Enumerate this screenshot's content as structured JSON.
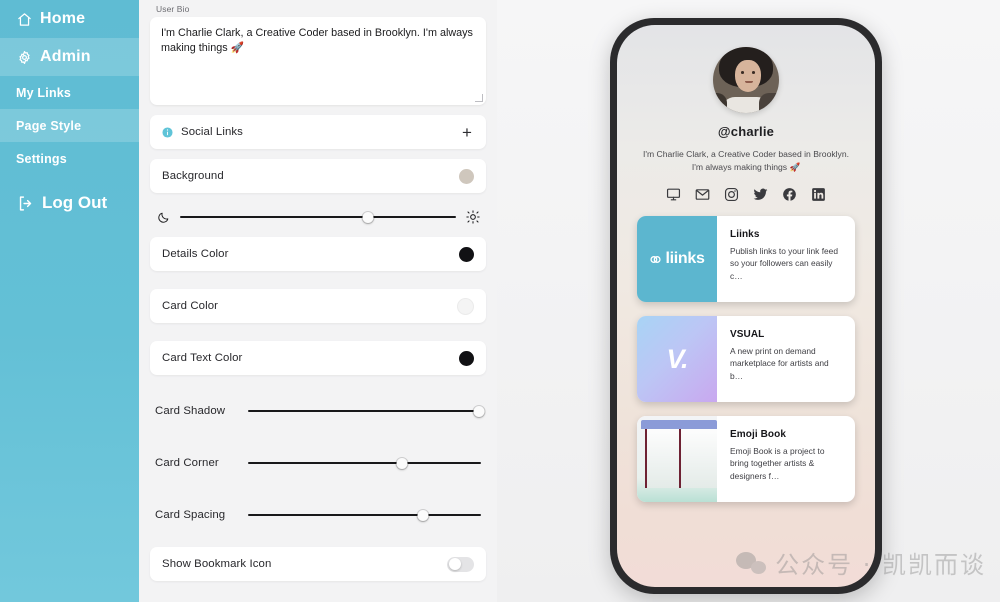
{
  "sidebar": {
    "items": [
      {
        "label": "Home",
        "icon": "home-icon",
        "size": "big",
        "active": false
      },
      {
        "label": "Admin",
        "icon": "gear-icon",
        "size": "big",
        "active": true
      },
      {
        "label": "My Links",
        "icon": "",
        "size": "small",
        "active": false
      },
      {
        "label": "Page Style",
        "icon": "",
        "size": "small",
        "active": true
      },
      {
        "label": "Settings",
        "icon": "",
        "size": "small",
        "active": false
      }
    ],
    "logout": {
      "label": "Log Out",
      "icon": "logout-icon"
    },
    "background_color": "#5fbcd3",
    "active_color": "#7cc9dc"
  },
  "form": {
    "bio": {
      "label": "User Bio",
      "value": "I'm Charlie Clark, a Creative Coder based in Brooklyn. I'm always making things 🚀"
    },
    "social_links": {
      "label": "Social Links",
      "add_label": "+",
      "icon": "info-circle-icon"
    },
    "background": {
      "label": "Background",
      "swatch_color": "#cfc7bd"
    },
    "brightness": {
      "left_icon": "moon-icon",
      "right_icon": "sun-icon",
      "value": 68
    },
    "details_color": {
      "label": "Details Color",
      "swatch_color": "#111114"
    },
    "card_color": {
      "label": "Card Color",
      "swatch_color": "#f4f4f4"
    },
    "card_text_color": {
      "label": "Card Text Color",
      "swatch_color": "#111114"
    },
    "card_shadow": {
      "label": "Card Shadow",
      "value": 99
    },
    "card_corner": {
      "label": "Card Corner",
      "value": 66
    },
    "card_spacing": {
      "label": "Card Spacing",
      "value": 75
    },
    "show_bookmark_icon": {
      "label": "Show Bookmark Icon",
      "enabled": false
    }
  },
  "preview": {
    "handle": "@charlie",
    "bio": "I'm Charlie Clark, a Creative Coder based in Brooklyn. I'm always making things 🚀",
    "avatar_name": "avatar",
    "social_icons": [
      "monitor-icon",
      "email-icon",
      "instagram-icon",
      "twitter-icon",
      "facebook-icon",
      "linkedin-icon"
    ],
    "cards": [
      {
        "title": "Liinks",
        "description": "Publish links to your link feed so your followers can easily c…",
        "thumb_text": "liinks",
        "thumb_style": "th-liinks"
      },
      {
        "title": "VSUAL",
        "description": "A new print on demand marketplace for artists and b…",
        "thumb_text": "V.",
        "thumb_style": "th-vsual"
      },
      {
        "title": "Emoji Book",
        "description": "Emoji Book is a project to bring together artists & designers f…",
        "thumb_text": "",
        "thumb_style": "th-emoji"
      }
    ]
  },
  "watermark": {
    "text": "公众号 · 凯凯而谈",
    "icon": "wechat-icon"
  }
}
